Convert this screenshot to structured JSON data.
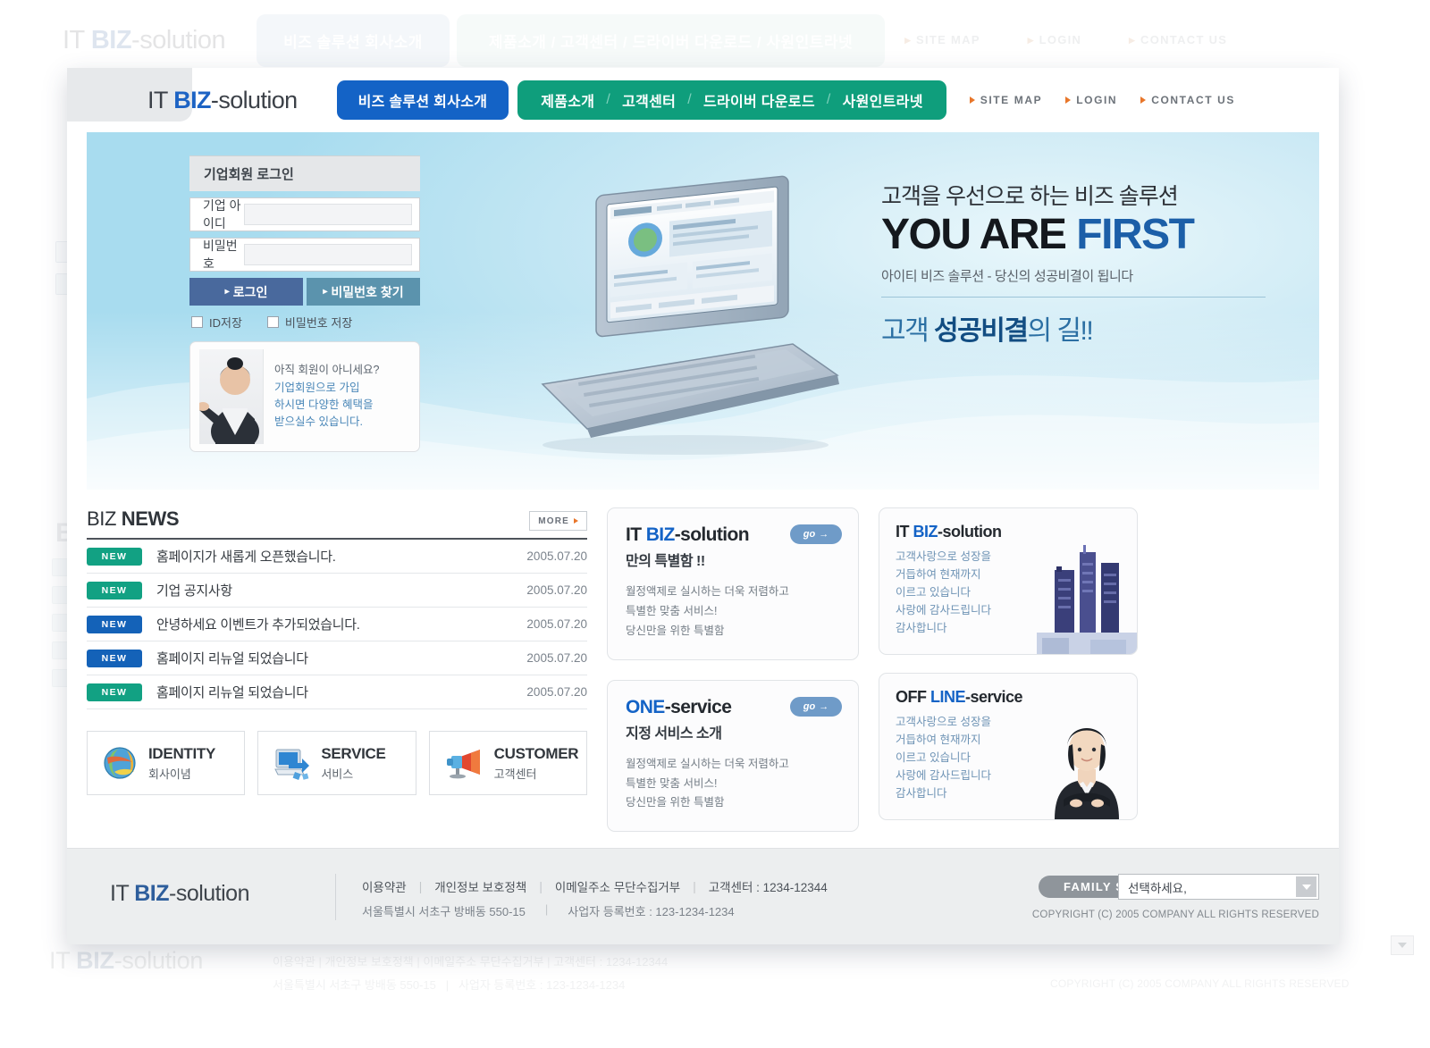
{
  "brand": {
    "prefix": "IT ",
    "mark": "BIZ",
    "suffix": "-solution"
  },
  "header": {
    "primary_tab": "비즈 솔루션 회사소개",
    "nav_items": [
      "제품소개",
      "고객센터",
      "드라이버 다운로드",
      "사원인트라넷"
    ],
    "nav_separator": "/",
    "utility": [
      "SITE MAP",
      "LOGIN",
      "CONTACT US"
    ]
  },
  "login": {
    "title": "기업회원 로그인",
    "id_label": "기업 아이디",
    "id_value": "",
    "id_placeholder": "",
    "pw_label": "비밀번호",
    "pw_value": "",
    "pw_placeholder": "",
    "login_button": "로그인",
    "find_button": "비밀번호 찾기",
    "arrow": "▸",
    "save_id": "ID저장",
    "save_pw": "비밀번호 저장"
  },
  "promo": {
    "line1": "아직 회원이 아니세요?",
    "line2": "기업회원으로 가입",
    "line3": "하시면 다양한 혜택을",
    "line4": "받으실수 있습니다."
  },
  "hero": {
    "kr_top": "고객을 우선으로 하는 비즈 솔루션",
    "en_plain": "YOU ARE ",
    "en_accent": "FIRST",
    "kr_sub": "아이티 비즈 솔루션 - 당신의 성공비결이 됩니다",
    "kr_bottom_a": "고객 ",
    "kr_bottom_b": "성공비결",
    "kr_bottom_c": "의 길!!"
  },
  "news": {
    "title_plain": "BIZ ",
    "title_bold": "NEWS",
    "more_label": "MORE",
    "rows": [
      {
        "badge": "NEW",
        "badge_color": "#12a183",
        "title": "홈페이지가 새롭게 오픈했습니다.",
        "date": "2005.07.20"
      },
      {
        "badge": "NEW",
        "badge_color": "#12a183",
        "title": "기업 공지사항",
        "date": "2005.07.20"
      },
      {
        "badge": "NEW",
        "badge_color": "#1462b8",
        "title": "안녕하세요 이벤트가 추가되었습니다.",
        "date": "2005.07.20"
      },
      {
        "badge": "NEW",
        "badge_color": "#1462b8",
        "title": "홈페이지 리뉴얼 되었습니다",
        "date": "2005.07.20"
      },
      {
        "badge": "NEW",
        "badge_color": "#12a183",
        "title": "홈페이지 리뉴얼 되었습니다",
        "date": "2005.07.20"
      }
    ]
  },
  "shortcuts": [
    {
      "icon": "globe-icon",
      "en": "IDENTITY",
      "kr": "회사이념"
    },
    {
      "icon": "monitor-icon",
      "en": "SERVICE",
      "kr": "서비스"
    },
    {
      "icon": "megaphone-icon",
      "en": "CUSTOMER",
      "kr": "고객센터"
    }
  ],
  "mid_cards": [
    {
      "head_plain": "IT ",
      "head_mark": "BIZ",
      "head_tail": "-solution",
      "sub": "만의 특별함 !!",
      "body": "월정액제로 실시하는 더욱 저렴하고\n특별한 맞춤 서비스!\n당신만을 위한 특별함",
      "go": "go"
    },
    {
      "head_plain": "ONE",
      "head_mark": "",
      "head_tail": "-service",
      "sub": "지정 서비스 소개",
      "body": "월정액제로 실시하는 더욱 저렴하고\n특별한 맞춤 서비스!\n당신만을 위한 특별함",
      "go": "go"
    }
  ],
  "right_cards": [
    {
      "head_plain": "IT ",
      "head_mark": "BIZ",
      "head_tail": "-solution",
      "body": "고객사랑으로 성장을\n거듭하여 현재까지\n이르고 있습니다\n사랑에 감사드립니다\n감사합니다",
      "image": "city-buildings-image"
    },
    {
      "head_plain": "OFF ",
      "head_mark": "LINE",
      "head_tail": "-service",
      "body": "고객사랑으로 성장을\n거듭하여 현재까지\n이르고 있습니다\n사랑에 감사드립니다\n감사합니다",
      "image": "businesswoman-image"
    }
  ],
  "footer": {
    "links": [
      "이용약관",
      "개인정보 보호정책",
      "이메일주소 무단수집거부",
      "고객센터 : 1234-12344"
    ],
    "address": "서울특별시 서초구 방배동 550-15",
    "biz_no": "사업자 등록번호 : 123-1234-1234",
    "family_site_label": "FAMILY SITE",
    "family_site_value": "선택하세요,",
    "copyright": "COPYRIGHT (C) 2005 COMPANY ALL RIGHTS RESERVED"
  },
  "colors": {
    "nav_blue": "#1463c6",
    "nav_green": "#0f9e7c",
    "accent_orange": "#e8762a",
    "badge_teal": "#12a183",
    "badge_blue": "#1462b8"
  }
}
